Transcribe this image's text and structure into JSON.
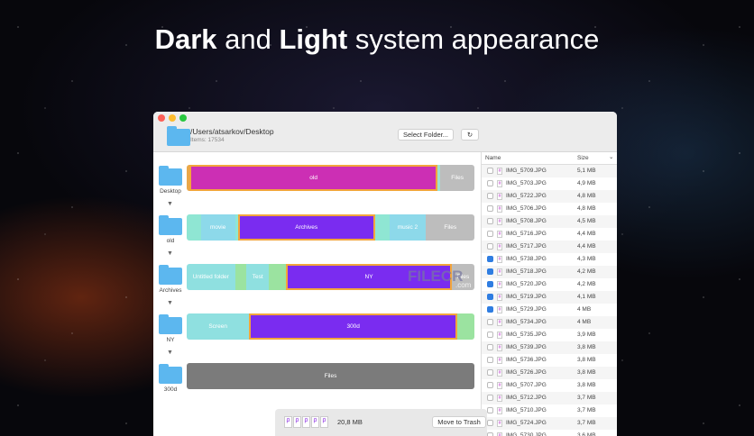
{
  "headline": {
    "bold1": "Dark",
    "mid": " and ",
    "bold2": "Light",
    "rest": " system appearance"
  },
  "header": {
    "path": "/Users/atsarkov/Desktop",
    "items": "Items: 17534",
    "select_folder": "Select Folder...",
    "refresh_icon": "↻"
  },
  "levels": [
    {
      "folder": "Desktop",
      "segments": [
        {
          "label": "",
          "color": "#e9a84a",
          "share": 1
        },
        {
          "label": "old",
          "color": "#cc2fb4",
          "share": 86,
          "selected": true
        },
        {
          "label": "",
          "color": "#9fe3d0",
          "share": 1
        },
        {
          "label": "Files",
          "color": "#bdbdbd",
          "share": 12
        }
      ]
    },
    {
      "folder": "old",
      "segments": [
        {
          "label": "",
          "color": "#8fe6d3",
          "share": 5
        },
        {
          "label": "movie",
          "color": "#8dd9ea",
          "share": 12
        },
        {
          "label": "",
          "color": "#8fe6d3",
          "share": 1
        },
        {
          "label": "Archives",
          "color": "#7a2cf0",
          "share": 47,
          "selected": true
        },
        {
          "label": "",
          "color": "#8fe6d3",
          "share": 5
        },
        {
          "label": "music 2",
          "color": "#8dd9ea",
          "share": 13
        },
        {
          "label": "Files",
          "color": "#bdbdbd",
          "share": 17
        }
      ]
    },
    {
      "folder": "Archives",
      "segments": [
        {
          "label": "Untitled folder",
          "color": "#8fe0e0",
          "share": 17
        },
        {
          "label": "",
          "color": "#9be3a0",
          "share": 4
        },
        {
          "label": "Test",
          "color": "#8fe0e0",
          "share": 8
        },
        {
          "label": "",
          "color": "#9be3a0",
          "share": 6
        },
        {
          "label": "NY",
          "color": "#7a2cf0",
          "share": 57,
          "selected": true
        },
        {
          "label": "Files",
          "color": "#bdbdbd",
          "share": 8
        }
      ]
    },
    {
      "folder": "NY",
      "segments": [
        {
          "label": "Screen",
          "color": "#8fe0e0",
          "share": 22
        },
        {
          "label": "300d",
          "color": "#7a2cf0",
          "share": 72,
          "selected": true
        },
        {
          "label": "",
          "color": "#9be3a0",
          "share": 6
        }
      ]
    },
    {
      "folder": "300d",
      "segments": [
        {
          "label": "Files",
          "color": "#7b7b7b",
          "share": 100
        }
      ]
    }
  ],
  "list": {
    "col_name": "Name",
    "col_size": "Size",
    "sort_icon": "⌄",
    "rows": [
      {
        "name": "IMG_5709.JPG",
        "size": "5,1 MB",
        "checked": false
      },
      {
        "name": "IMG_5703.JPG",
        "size": "4,9 MB",
        "checked": false
      },
      {
        "name": "IMG_5722.JPG",
        "size": "4,8 MB",
        "checked": false
      },
      {
        "name": "IMG_5706.JPG",
        "size": "4,8 MB",
        "checked": false
      },
      {
        "name": "IMG_5708.JPG",
        "size": "4,5 MB",
        "checked": false
      },
      {
        "name": "IMG_5716.JPG",
        "size": "4,4 MB",
        "checked": false
      },
      {
        "name": "IMG_5717.JPG",
        "size": "4,4 MB",
        "checked": false
      },
      {
        "name": "IMG_5738.JPG",
        "size": "4,3 MB",
        "checked": true
      },
      {
        "name": "IMG_5718.JPG",
        "size": "4,2 MB",
        "checked": true
      },
      {
        "name": "IMG_5720.JPG",
        "size": "4,2 MB",
        "checked": true
      },
      {
        "name": "IMG_5719.JPG",
        "size": "4,1 MB",
        "checked": true
      },
      {
        "name": "IMG_5729.JPG",
        "size": "4 MB",
        "checked": true
      },
      {
        "name": "IMG_5734.JPG",
        "size": "4 MB",
        "checked": false
      },
      {
        "name": "IMG_5735.JPG",
        "size": "3,9 MB",
        "checked": false
      },
      {
        "name": "IMG_5739.JPG",
        "size": "3,8 MB",
        "checked": false
      },
      {
        "name": "IMG_5736.JPG",
        "size": "3,8 MB",
        "checked": false
      },
      {
        "name": "IMG_5726.JPG",
        "size": "3,8 MB",
        "checked": false
      },
      {
        "name": "IMG_5707.JPG",
        "size": "3,8 MB",
        "checked": false
      },
      {
        "name": "IMG_5712.JPG",
        "size": "3,7 MB",
        "checked": false
      },
      {
        "name": "IMG_5710.JPG",
        "size": "3,7 MB",
        "checked": false
      },
      {
        "name": "IMG_5724.JPG",
        "size": "3,7 MB",
        "checked": false
      },
      {
        "name": "IMG_5730.JPG",
        "size": "3,6 MB",
        "checked": false
      }
    ]
  },
  "bottom": {
    "total": "20,8 MB",
    "trash": "Move to Trash",
    "thumb_count": 5
  },
  "watermark": {
    "text": "FILECR",
    "sub": ".com"
  }
}
